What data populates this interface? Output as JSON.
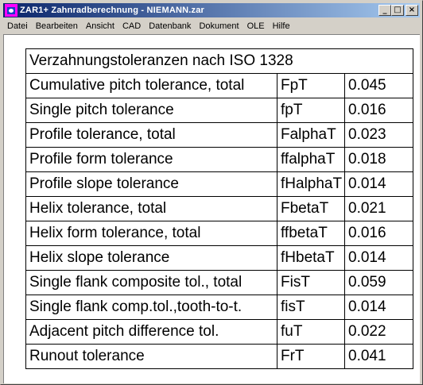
{
  "window": {
    "title": "ZAR1+  Zahnradberechnung - NIEMANN.zar",
    "minimize_glyph": "_",
    "maximize_glyph": "□",
    "close_glyph": "×"
  },
  "menu": [
    {
      "label": "Datei",
      "key": "menu-datei"
    },
    {
      "label": "Bearbeiten",
      "key": "menu-bearbeiten"
    },
    {
      "label": "Ansicht",
      "key": "menu-ansicht"
    },
    {
      "label": "CAD",
      "key": "menu-cad"
    },
    {
      "label": "Datenbank",
      "key": "menu-datenbank"
    },
    {
      "label": "Dokument",
      "key": "menu-dokument"
    },
    {
      "label": "OLE",
      "key": "menu-ole"
    },
    {
      "label": "Hilfe",
      "key": "menu-hilfe"
    }
  ],
  "table": {
    "header": "Verzahnungstoleranzen nach ISO 1328",
    "rows": [
      {
        "name": "Cumulative pitch tolerance, total",
        "symbol": "FpT",
        "value": "0.045"
      },
      {
        "name": "Single pitch tolerance",
        "symbol": "fpT",
        "value": "0.016"
      },
      {
        "name": "Profile tolerance, total",
        "symbol": "FalphaT",
        "value": "0.023"
      },
      {
        "name": "Profile form tolerance",
        "symbol": "ffalphaT",
        "value": "0.018"
      },
      {
        "name": "Profile slope tolerance",
        "symbol": "fHalphaT",
        "value": "0.014"
      },
      {
        "name": "Helix tolerance, total",
        "symbol": "FbetaT",
        "value": "0.021"
      },
      {
        "name": "Helix form tolerance, total",
        "symbol": "ffbetaT",
        "value": "0.016"
      },
      {
        "name": "Helix slope tolerance",
        "symbol": "fHbetaT",
        "value": "0.014"
      },
      {
        "name": "Single flank composite tol., total",
        "symbol": "FisT",
        "value": "0.059"
      },
      {
        "name": "Single flank comp.tol.,tooth-to-t.",
        "symbol": "fisT",
        "value": "0.014"
      },
      {
        "name": "Adjacent pitch difference tol.",
        "symbol": "fuT",
        "value": "0.022"
      },
      {
        "name": "Runout tolerance",
        "symbol": "FrT",
        "value": "0.041"
      }
    ]
  }
}
